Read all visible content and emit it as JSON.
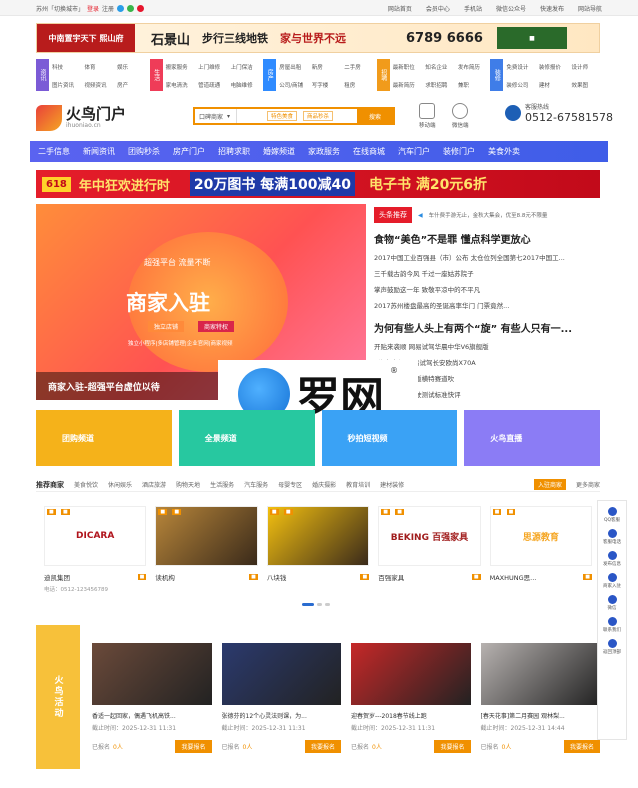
{
  "topbar": {
    "left": "苏州「切换城市」",
    "login": "登录",
    "reg": "注册",
    "links": [
      "网站首页",
      "会员中心",
      "手机站",
      "微信公众号",
      "快速发布",
      "网站导航"
    ]
  },
  "banner1": {
    "brand": "中南置宇天下",
    "a": "熙山府",
    "b": "石景山",
    "c": "步行三线地铁",
    "d": "家与世界不远",
    "phone": "6789 6666"
  },
  "categories": [
    {
      "label": "资讯",
      "color": "#7b5bd6",
      "items": [
        "科技",
        "体育",
        "娱乐",
        "图片资讯",
        "视频资讯",
        "房产"
      ]
    },
    {
      "label": "生活",
      "color": "#ef3c58",
      "items": [
        "搬家服务",
        "上门维修",
        "上门保洁",
        "家电清洗",
        "管道疏通",
        "电脑维修"
      ]
    },
    {
      "label": "房产",
      "color": "#2f8bff",
      "items": [
        "房屋出租",
        "新房",
        "二手房",
        "公司/商铺",
        "写字楼",
        "租房"
      ]
    },
    {
      "label": "招聘",
      "color": "#f19b1b",
      "items": [
        "最新职位",
        "知名企业",
        "发布简历",
        "最新简历",
        "求职招聘",
        "兼职"
      ]
    },
    {
      "label": "装修",
      "color": "#3f7de8",
      "items": [
        "免费设计",
        "装修报价",
        "设计师",
        "装修公司",
        "建材",
        "效果图"
      ]
    }
  ],
  "logo": {
    "name": "火鸟门户",
    "domain": "ihuoniao.cn"
  },
  "search": {
    "select": "口碑商家",
    "tags": [
      "特色美食",
      "商品秒杀"
    ],
    "button": "搜索"
  },
  "qr": [
    {
      "label": "移动端"
    },
    {
      "label": "微信端"
    }
  ],
  "hotline": {
    "label": "客服热线",
    "number": "0512-67581578"
  },
  "nav": [
    "二手信息",
    "新闻资讯",
    "团购秒杀",
    "房产门户",
    "招聘求职",
    "婚嫁频道",
    "家政服务",
    "在线商城",
    "汽车门户",
    "装修门户",
    "美食外卖"
  ],
  "banner2": {
    "a": "618",
    "b": "年中狂欢进行时",
    "c": "20万图书 每满100减40",
    "d": "电子书 满20元6折"
  },
  "hero": {
    "line1": "超强平台 流量不断",
    "title": "商家入驻",
    "pill1": "独立店铺",
    "pill2": "商家特权",
    "line2": "独立小程序|多店铺管理|企业官网|商家视频",
    "caption": "商家入驻-超强平台虚位以待"
  },
  "news": {
    "tab": "头条推荐",
    "ticker": "车什费手游无止，金秋大集会，优至8.8元不限量",
    "h1": "食物“美色”不是罪 懂点科学更放心",
    "items1": [
      "2017中国工业百强县（市）公布 太仓位列全国第七2017中国工...",
      "三千载古韵今风 千过一座姑苏院子",
      "掌声鼓励这一年 致敬平凉中的不平凡",
      "2017苏州楼盘最高的圣诞高率华门 门票竟然..."
    ],
    "h2": "为何有些人头上有两个“旋” 有些人只有一...",
    "items2": [
      "开贴来袭顺 网易试驾华晨中华V6旗舰版",
      "X汽车市场 网易试驾长安欧尚X70A",
      "城 评值电混动版横特赛道吹",
      "万 北京自动驾驶测试标准快评"
    ]
  },
  "watermark": {
    "text": "罗网"
  },
  "channels": [
    {
      "label": "团购频道",
      "color": "#f5b21a"
    },
    {
      "label": "全景频道",
      "color": "#27c8a0"
    },
    {
      "label": "秒拍短视频",
      "color": "#3aa2f5"
    },
    {
      "label": "火鸟直播",
      "color": "#8b7cf5"
    }
  ],
  "recommend": {
    "title": "推荐商家",
    "items": [
      "美食悦饮",
      "休闲娱乐",
      "酒店旅游",
      "购物天地",
      "生活服务",
      "汽车服务",
      "母婴专区",
      "婚庆摄影",
      "教育培训",
      "建材装修"
    ],
    "enter": "入驻商家",
    "more": "更多商家"
  },
  "merchants": [
    {
      "name": "迪凯集团",
      "logo": "DICARA",
      "phone": "电话：0512-123456789",
      "color": "#b0141c"
    },
    {
      "name": "读机构",
      "logo": "",
      "phone": "",
      "color": "#b8863a"
    },
    {
      "name": "八块钱",
      "logo": "",
      "phone": "",
      "color": "#f3c010"
    },
    {
      "name": "百强家具",
      "logo": "BEKING 百强家具",
      "phone": "",
      "color": "#a01c1c"
    },
    {
      "name": "MAXHUNG思...",
      "logo": "思源教育",
      "phone": "",
      "color": "#f5a623"
    }
  ],
  "activity": {
    "label": "火鸟活动",
    "items": [
      {
        "title": "香适一起回家，偶遇飞机高铁...",
        "date": "截止时间：2025-12-31 11:31",
        "joined": "已报名",
        "count": "0人",
        "btn": "我要报名",
        "color": "#6b4a3a"
      },
      {
        "title": "张德芬的12个心灵法则课，为...",
        "date": "截止时间：2025-12-31 11:31",
        "joined": "已报名",
        "count": "0人",
        "btn": "我要报名",
        "color": "#2b3a6e"
      },
      {
        "title": "迎春贺岁---2018春节线上跑",
        "date": "截止时间：2025-12-31 11:31",
        "joined": "已报名",
        "count": "0人",
        "btn": "我要报名",
        "color": "#c62828"
      },
      {
        "title": "[春天花事]第二月赛园 观林梨...",
        "date": "截止时间：2025-12-31 14:44",
        "joined": "已报名",
        "count": "0人",
        "btn": "我要报名",
        "color": "#b7b2b0"
      }
    ]
  },
  "side": [
    "QQ客服",
    "客服电话",
    "发布信息",
    "商家入驻",
    "微信",
    "联系我们",
    "返回顶部"
  ]
}
